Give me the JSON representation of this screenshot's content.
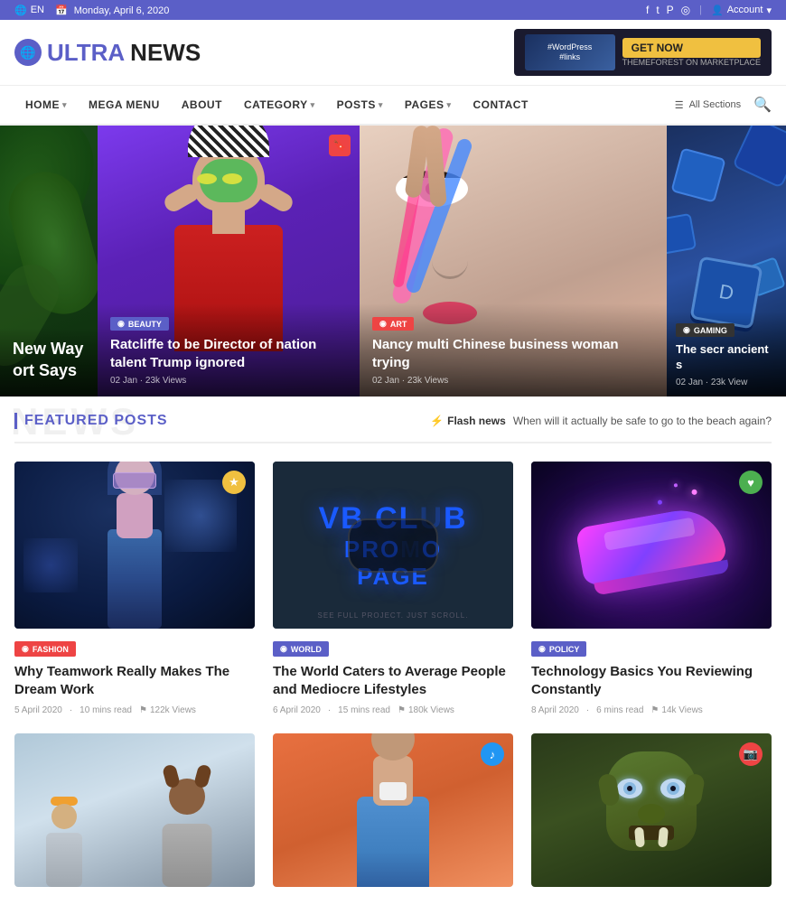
{
  "topbar": {
    "lang": "EN",
    "date": "Monday, April 6, 2020",
    "account": "Account"
  },
  "header": {
    "logo_text_ultra": "ULTRA",
    "logo_text_news": "NEWS",
    "ad_btn": "GET NOW",
    "ad_sub": "THEMEFOREST ON MARKETPLACE"
  },
  "nav": {
    "items": [
      {
        "label": "HOME",
        "has_dropdown": true
      },
      {
        "label": "MEGA MENU",
        "has_dropdown": false
      },
      {
        "label": "ABOUT",
        "has_dropdown": false
      },
      {
        "label": "CATEGORY",
        "has_dropdown": true
      },
      {
        "label": "POSTS",
        "has_dropdown": true
      },
      {
        "label": "PAGES",
        "has_dropdown": true
      },
      {
        "label": "CONTACT",
        "has_dropdown": false
      }
    ],
    "all_sections": "All Sections"
  },
  "hero": {
    "slides": [
      {
        "id": 1,
        "title": "New Way ort Says",
        "category": "",
        "meta": ""
      },
      {
        "id": 2,
        "category": "BEAUTY",
        "title": "Ratcliffe to be Director of nation talent Trump ignored",
        "meta": "02 Jan · 23k Views"
      },
      {
        "id": 3,
        "category": "ART",
        "title": "Nancy multi Chinese business woman trying",
        "meta": "02 Jan · 23k Views"
      },
      {
        "id": 4,
        "category": "GAMING",
        "title": "The secr ancient s",
        "meta": "02 Jan · 23k View"
      }
    ]
  },
  "featured": {
    "section_bg_text": "NEWS",
    "section_title": "FEATURED POSTS",
    "flash_label": "Flash news",
    "flash_text": "When will it actually be safe to go to the beach again?"
  },
  "cards": [
    {
      "id": 1,
      "category": "FASHION",
      "cat_class": "cat-fashion",
      "bookmark_class": "yellow",
      "bookmark_icon": "★",
      "title": "Why Teamwork Really Makes The Dream Work",
      "date": "5 April 2020",
      "read_time": "10 mins read",
      "views": "122k Views",
      "img_type": "cyber-girl"
    },
    {
      "id": 2,
      "category": "WORLD",
      "cat_class": "cat-world",
      "bookmark_class": "",
      "title": "The World Caters to Average People and Mediocre Lifestyles",
      "date": "6 April 2020",
      "read_time": "15 mins read",
      "views": "180k Views",
      "img_type": "vr"
    },
    {
      "id": 3,
      "category": "POLICY",
      "cat_class": "cat-policy",
      "bookmark_class": "green",
      "bookmark_icon": "♥",
      "title": "Technology Basics You Reviewing Constantly",
      "date": "8 April 2020",
      "read_time": "6 mins read",
      "views": "14k Views",
      "img_type": "sneaker"
    }
  ],
  "bottom_cards": [
    {
      "id": 4,
      "img_type": "toys"
    },
    {
      "id": 5,
      "img_type": "man",
      "bookmark_icon": "♪",
      "bookmark_class": "blue"
    },
    {
      "id": 6,
      "img_type": "troll",
      "bookmark_icon": "📷",
      "bookmark_class": "red"
    }
  ],
  "icons": {
    "globe": "🌐",
    "calendar": "📅",
    "user": "👤",
    "search": "🔍",
    "menu": "☰",
    "bookmark": "🔖",
    "flag": "⚑",
    "dot": "◉",
    "twitter": "𝕋",
    "facebook": "f",
    "pinterest": "P",
    "instagram": "◎",
    "lightning": "⚡"
  }
}
